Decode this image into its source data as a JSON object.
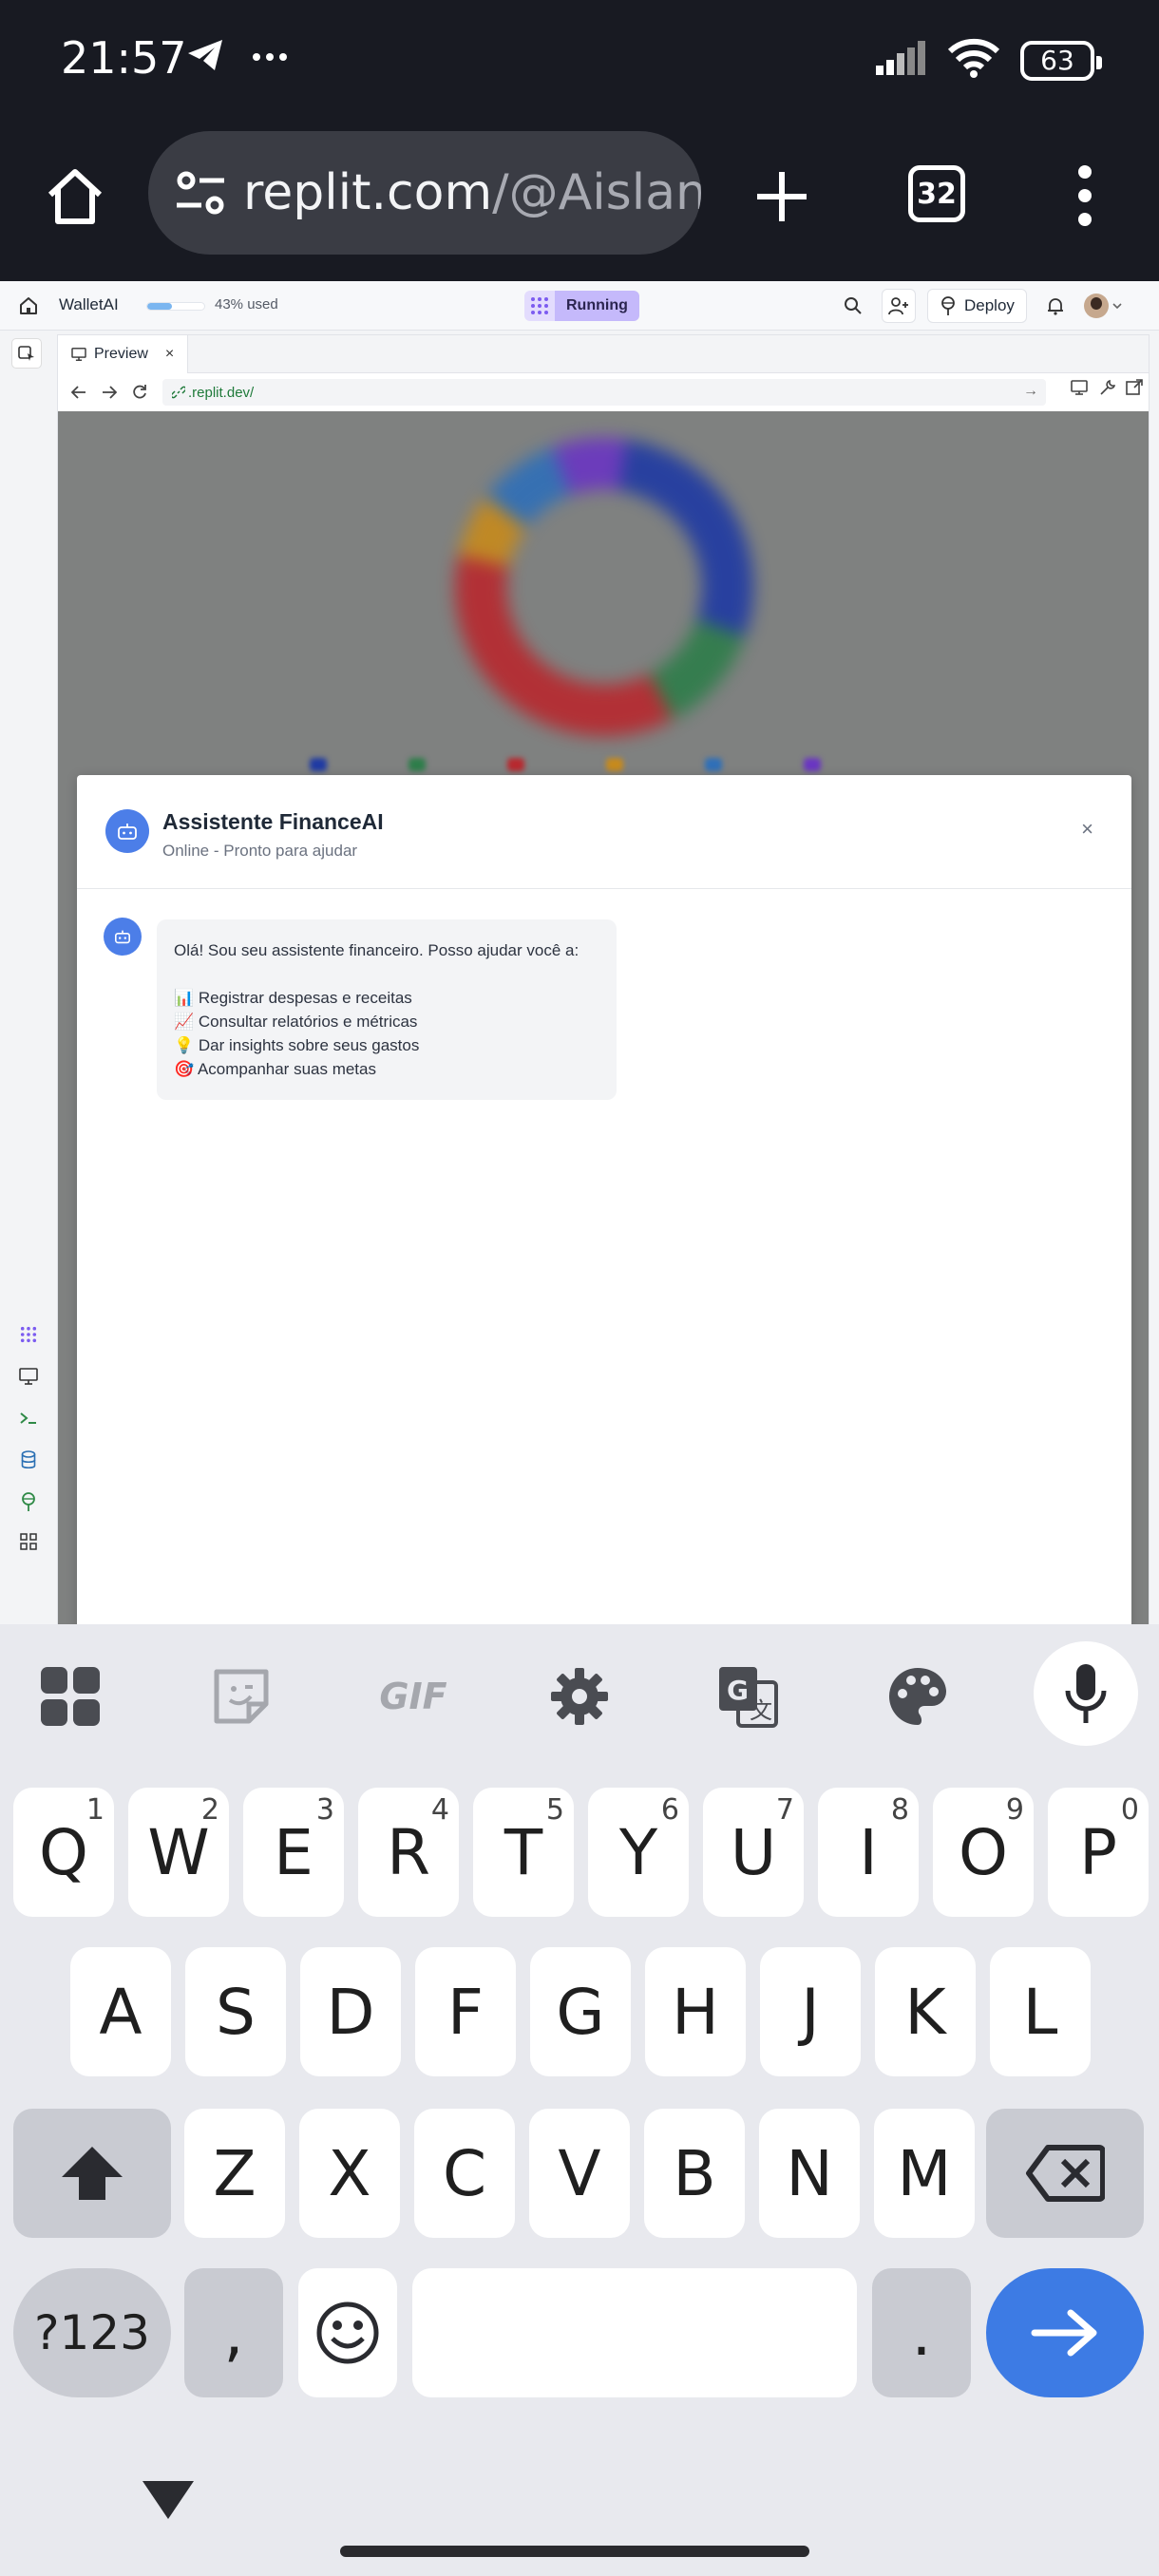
{
  "status_bar": {
    "time": "21:57",
    "battery": "63"
  },
  "browser": {
    "url_host": "replit.com",
    "url_path": "/@Aislanc",
    "tab_count": "32"
  },
  "replit": {
    "app_name": "WalletAI",
    "usage_percent": 43,
    "usage_text": "43% used",
    "status": "Running",
    "deploy_label": "Deploy",
    "tab_label": "Preview",
    "tab_close": "×",
    "address": ".replit.dev/"
  },
  "chart_data": {
    "type": "pie",
    "note_visible": "blurred donut behind modal",
    "slices": [
      {
        "color": "#1f3aa3",
        "value": 28
      },
      {
        "color": "#2e7d4a",
        "value": 12
      },
      {
        "color": "#b8282e",
        "value": 36
      },
      {
        "color": "#c78a1c",
        "value": 7
      },
      {
        "color": "#2f6fb8",
        "value": 9
      },
      {
        "color": "#6a35c2",
        "value": 8
      }
    ]
  },
  "chat": {
    "title": "Assistente FinanceAI",
    "subtitle": "Online - Pronto para ajudar",
    "close": "×",
    "greeting": "Olá! Sou seu assistente financeiro. Posso ajudar você a:",
    "items": [
      "📊 Registrar despesas e receitas",
      "📈 Consultar relatórios e métricas",
      "💡 Dar insights sobre seus gastos",
      "🎯 Acompanhar suas metas"
    ]
  },
  "keyboard": {
    "row1": [
      {
        "key": "Q",
        "hint": "1"
      },
      {
        "key": "W",
        "hint": "2"
      },
      {
        "key": "E",
        "hint": "3"
      },
      {
        "key": "R",
        "hint": "4"
      },
      {
        "key": "T",
        "hint": "5"
      },
      {
        "key": "Y",
        "hint": "6"
      },
      {
        "key": "U",
        "hint": "7"
      },
      {
        "key": "I",
        "hint": "8"
      },
      {
        "key": "O",
        "hint": "9"
      },
      {
        "key": "P",
        "hint": "0"
      }
    ],
    "row2": [
      "A",
      "S",
      "D",
      "F",
      "G",
      "H",
      "J",
      "K",
      "L"
    ],
    "row3": [
      "Z",
      "X",
      "C",
      "V",
      "B",
      "N",
      "M"
    ],
    "symbols": "?123",
    "comma": ",",
    "period": ".",
    "toolbar_gif": "GIF"
  }
}
